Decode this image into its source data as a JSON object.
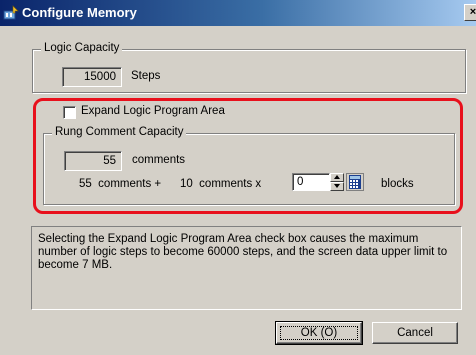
{
  "window": {
    "title": "Configure Memory",
    "close_glyph": "×"
  },
  "logic_capacity": {
    "group_label": "Logic Capacity",
    "value": "15000",
    "unit": "Steps"
  },
  "expand": {
    "label": "Expand Logic Program Area",
    "checked": false
  },
  "rung_comment": {
    "group_label": "Rung Comment Capacity",
    "value": "55",
    "unit": "comments",
    "formula_part1": "55  comments +",
    "formula_part2": "10  comments x",
    "blocks_value": "0",
    "blocks_label": "blocks"
  },
  "info_text": "Selecting the Expand Logic Program Area check box causes the maximum number of logic steps to become 60000 steps, and the screen data upper limit to become 7 MB.",
  "buttons": {
    "ok": "OK (O)",
    "cancel": "Cancel"
  },
  "highlight_color": "#e8101c"
}
